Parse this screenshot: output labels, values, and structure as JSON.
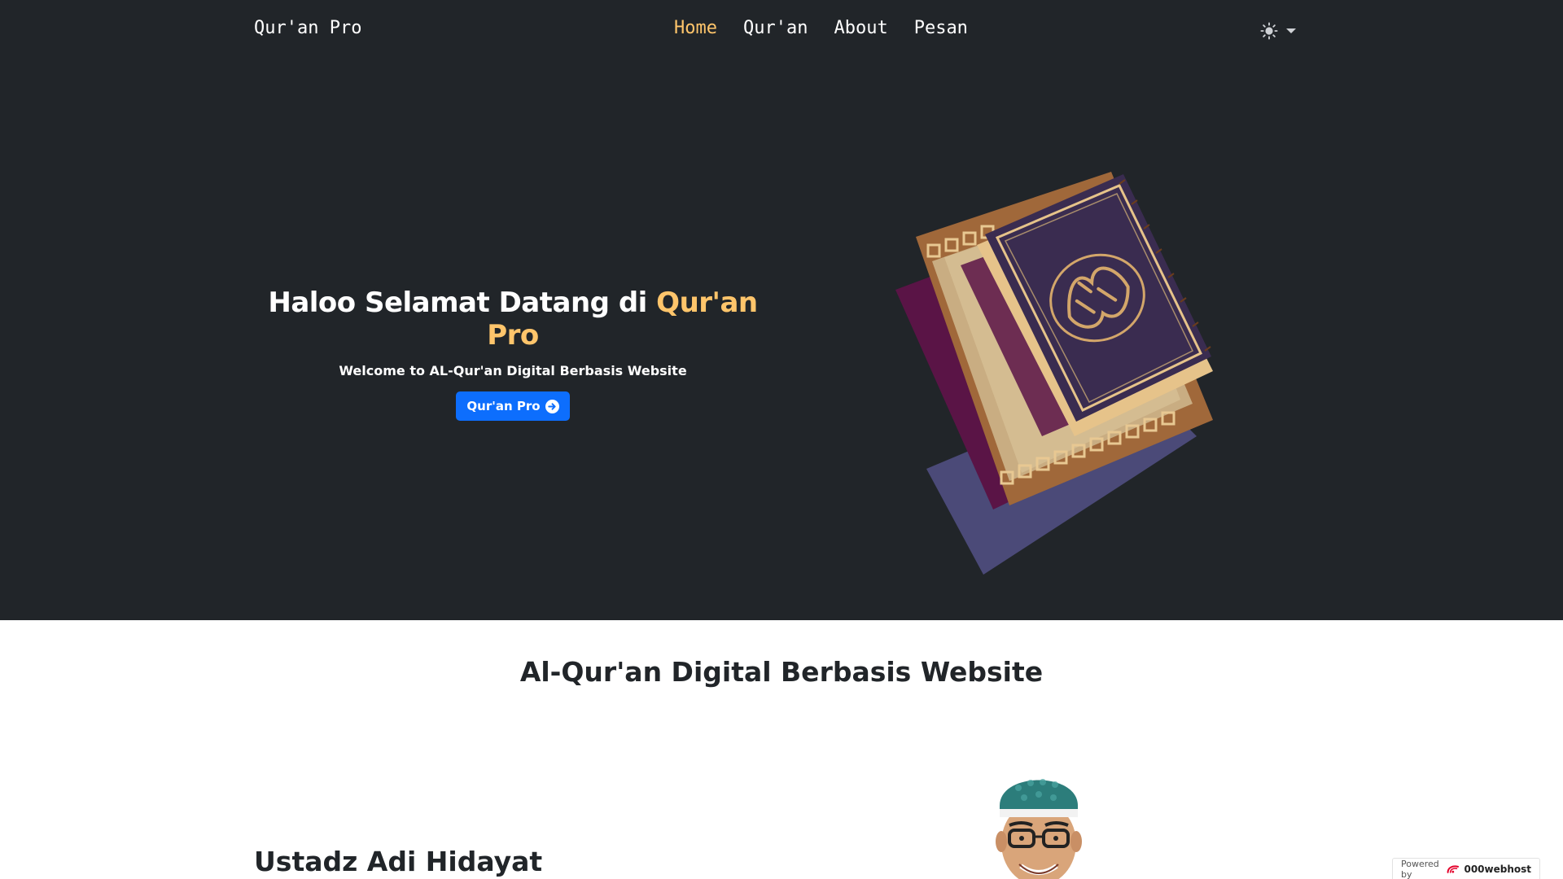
{
  "navbar": {
    "brand": "Qur'an Pro",
    "links": [
      {
        "label": "Home"
      },
      {
        "label": "Qur'an"
      },
      {
        "label": "About"
      },
      {
        "label": "Pesan"
      }
    ],
    "active_color": "#ffc56b",
    "theme_icon": "sun-icon"
  },
  "hero": {
    "title_prefix": "Haloo Selamat Datang di ",
    "title_accent": "Qur'an Pro",
    "subtitle": "Welcome to AL-Qur'an Digital Berbasis Website",
    "button_label": "Qur'an Pro",
    "button_icon": "arrow-right-circle-icon",
    "accent_color": "#ffc56b",
    "button_color": "#0d6efd",
    "background": "#212529"
  },
  "section": {
    "title": "Al-Qur'an Digital Berbasis Website"
  },
  "profile": {
    "name": "Ustadz Adi Hidayat"
  },
  "badge": {
    "powered_by": "Powered by",
    "brand": "000webhost"
  }
}
